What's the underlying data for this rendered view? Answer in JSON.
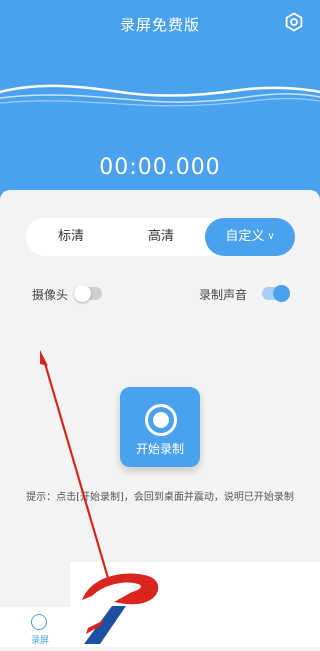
{
  "header": {
    "title": "录屏免费版",
    "settings_icon": "gear-icon",
    "timer": "00:00.000"
  },
  "quality": {
    "options": [
      "标清",
      "高清",
      "自定义"
    ],
    "selected": "自定义"
  },
  "switches": {
    "camera": {
      "label": "摄像头",
      "on": false
    },
    "audio": {
      "label": "录制声音",
      "on": true
    }
  },
  "record": {
    "label": "开始录制"
  },
  "hint": "提示：点击[开始录制]，会回到桌面并震动，说明已开始录制",
  "nav": {
    "items": [
      {
        "label": "录屏",
        "icon": "record-circle-icon"
      }
    ]
  },
  "colors": {
    "accent": "#4aa2ee",
    "annotation": "#d9251d"
  }
}
